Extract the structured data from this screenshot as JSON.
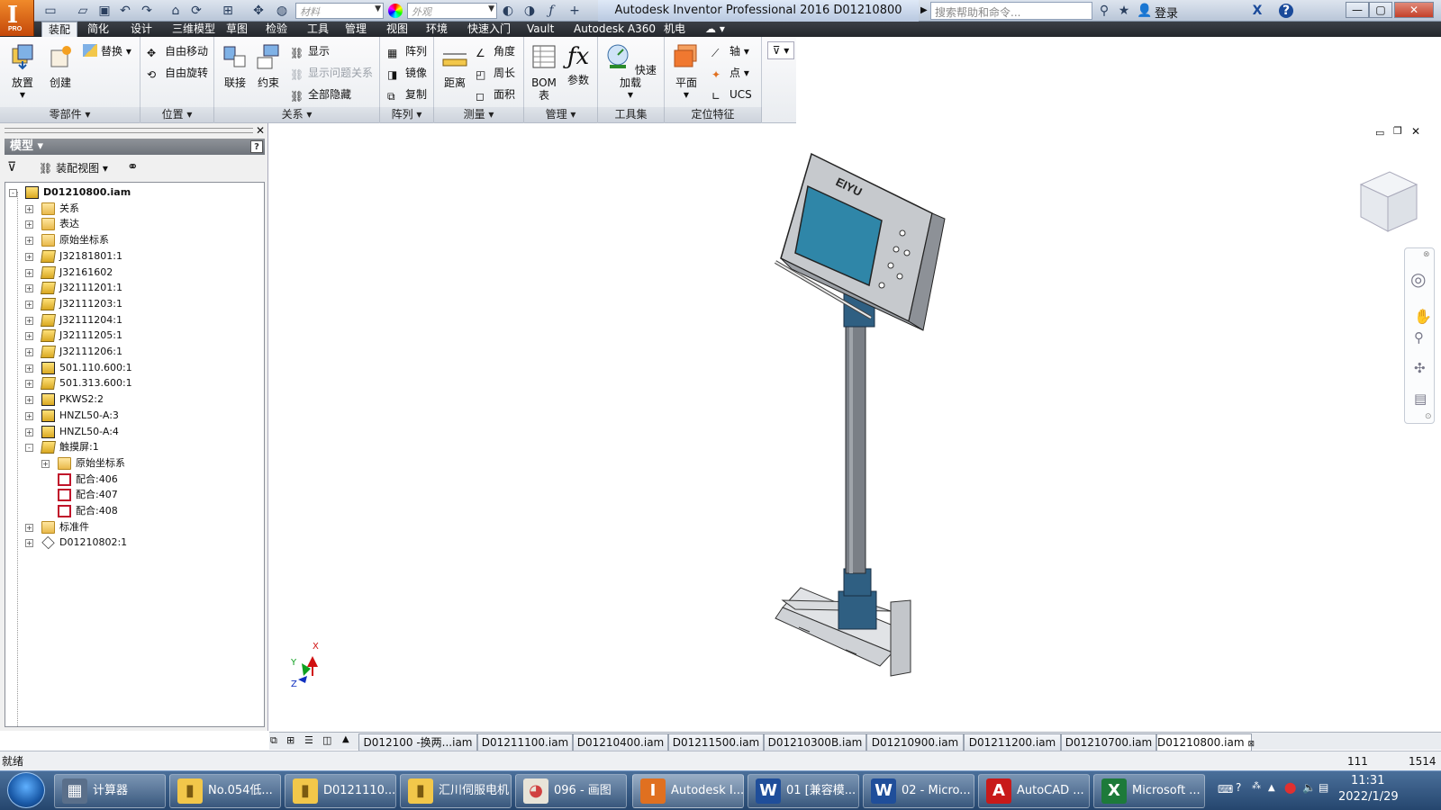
{
  "titlebar": {
    "window_title": "Autodesk Inventor Professional 2016     D01210800",
    "material_placeholder": "材料",
    "appearance_placeholder": "外观",
    "help_search": "搜索帮助和命令...",
    "login": "登录",
    "app_badge": "PRO"
  },
  "tabs": [
    "装配",
    "简化",
    "设计",
    "三维模型",
    "草图",
    "检验",
    "工具",
    "管理",
    "视图",
    "环境",
    "快速入门",
    "Vault",
    "Autodesk A360",
    "机电"
  ],
  "ribbon": {
    "components": {
      "place": "放置",
      "create": "创建",
      "replace": "替换",
      "title": "零部件"
    },
    "position": {
      "free_move": "自由移动",
      "free_rotate": "自由旋转",
      "title": "位置"
    },
    "relationships": {
      "joint": "联接",
      "constrain": "约束",
      "show": "显示",
      "show_sick": "显示问题关系",
      "hide_all": "全部隐藏",
      "title": "关系"
    },
    "pattern": {
      "pattern": "阵列",
      "mirror": "镜像",
      "copy": "复制",
      "title": "阵列"
    },
    "measure": {
      "distance": "距离",
      "angle": "角度",
      "loop": "周长",
      "area": "面积",
      "title": "测量"
    },
    "manage": {
      "bom": "BOM",
      "bom2": "表",
      "params": "参数",
      "title": "管理"
    },
    "productivity": {
      "express": "快速加载",
      "title": "工具集"
    },
    "work_features": {
      "plane": "平面",
      "axis": "轴",
      "point": "点",
      "ucs": "UCS",
      "title": "定位特征"
    }
  },
  "browser": {
    "header": "模型",
    "view_label": "装配视图",
    "tree": [
      {
        "label": "D01210800.iam",
        "level": 0,
        "icon": "asm",
        "exp": "-",
        "bold": true
      },
      {
        "label": "关系",
        "level": 1,
        "icon": "folder",
        "exp": "+"
      },
      {
        "label": "表达",
        "level": 1,
        "icon": "repr",
        "exp": "+"
      },
      {
        "label": "原始坐标系",
        "level": 1,
        "icon": "folder",
        "exp": "+"
      },
      {
        "label": "J32181801:1",
        "level": 1,
        "icon": "part",
        "exp": "+"
      },
      {
        "label": "J32161602",
        "level": 1,
        "icon": "part",
        "exp": "+"
      },
      {
        "label": "J32111201:1",
        "level": 1,
        "icon": "sheet",
        "exp": "+"
      },
      {
        "label": "J32111203:1",
        "level": 1,
        "icon": "part",
        "exp": "+"
      },
      {
        "label": "J32111204:1",
        "level": 1,
        "icon": "part",
        "exp": "+"
      },
      {
        "label": "J32111205:1",
        "level": 1,
        "icon": "part",
        "exp": "+"
      },
      {
        "label": "J32111206:1",
        "level": 1,
        "icon": "part",
        "exp": "+"
      },
      {
        "label": "501.110.600:1",
        "level": 1,
        "icon": "asm",
        "exp": "+"
      },
      {
        "label": "501.313.600:1",
        "level": 1,
        "icon": "part",
        "exp": "+"
      },
      {
        "label": "PKWS2:2",
        "level": 1,
        "icon": "asm",
        "exp": "+"
      },
      {
        "label": "HNZL50-A:3",
        "level": 1,
        "icon": "asm",
        "exp": "+"
      },
      {
        "label": "HNZL50-A:4",
        "level": 1,
        "icon": "asm",
        "exp": "+"
      },
      {
        "label": "触摸屏:1",
        "level": 1,
        "icon": "part",
        "exp": "-"
      },
      {
        "label": "原始坐标系",
        "level": 2,
        "icon": "folder",
        "exp": "+"
      },
      {
        "label": "配合:406",
        "level": 2,
        "icon": "mate",
        "exp": ""
      },
      {
        "label": "配合:407",
        "level": 2,
        "icon": "mate",
        "exp": ""
      },
      {
        "label": "配合:408",
        "level": 2,
        "icon": "mate",
        "exp": ""
      },
      {
        "label": "标准件",
        "level": 1,
        "icon": "folder",
        "exp": "+"
      },
      {
        "label": "D01210802:1",
        "level": 1,
        "icon": "weld",
        "exp": "+"
      }
    ]
  },
  "model": {
    "brand": "EIYU"
  },
  "triad": {
    "x": "X",
    "y": "Y",
    "z": "Z"
  },
  "doc_tabs": [
    "D012100 -换两...iam",
    "D01211100.iam",
    "D01210400.iam",
    "D01211500.iam",
    "D01210300B.iam",
    "D01210900.iam",
    "D01211200.iam",
    "D01210700.iam",
    "D01210800.iam"
  ],
  "status": {
    "text": "就绪",
    "count1": "111",
    "count2": "1514"
  },
  "taskbar": {
    "items": [
      {
        "label": "计算器",
        "icon": "calc"
      },
      {
        "label": "No.054低...",
        "icon": "folder"
      },
      {
        "label": "D0121110...",
        "icon": "folder"
      },
      {
        "label": "汇川伺服电机",
        "icon": "folder"
      },
      {
        "label": "096 - 画图",
        "icon": "paint"
      },
      {
        "label": "Autodesk I...",
        "icon": "inventor"
      },
      {
        "label": "01 [兼容模...",
        "icon": "word"
      },
      {
        "label": "02 - Micro...",
        "icon": "word"
      },
      {
        "label": "AutoCAD ...",
        "icon": "autocad"
      },
      {
        "label": "Microsoft ...",
        "icon": "excel"
      }
    ],
    "time": "11:31",
    "date": "2022/1/29"
  }
}
